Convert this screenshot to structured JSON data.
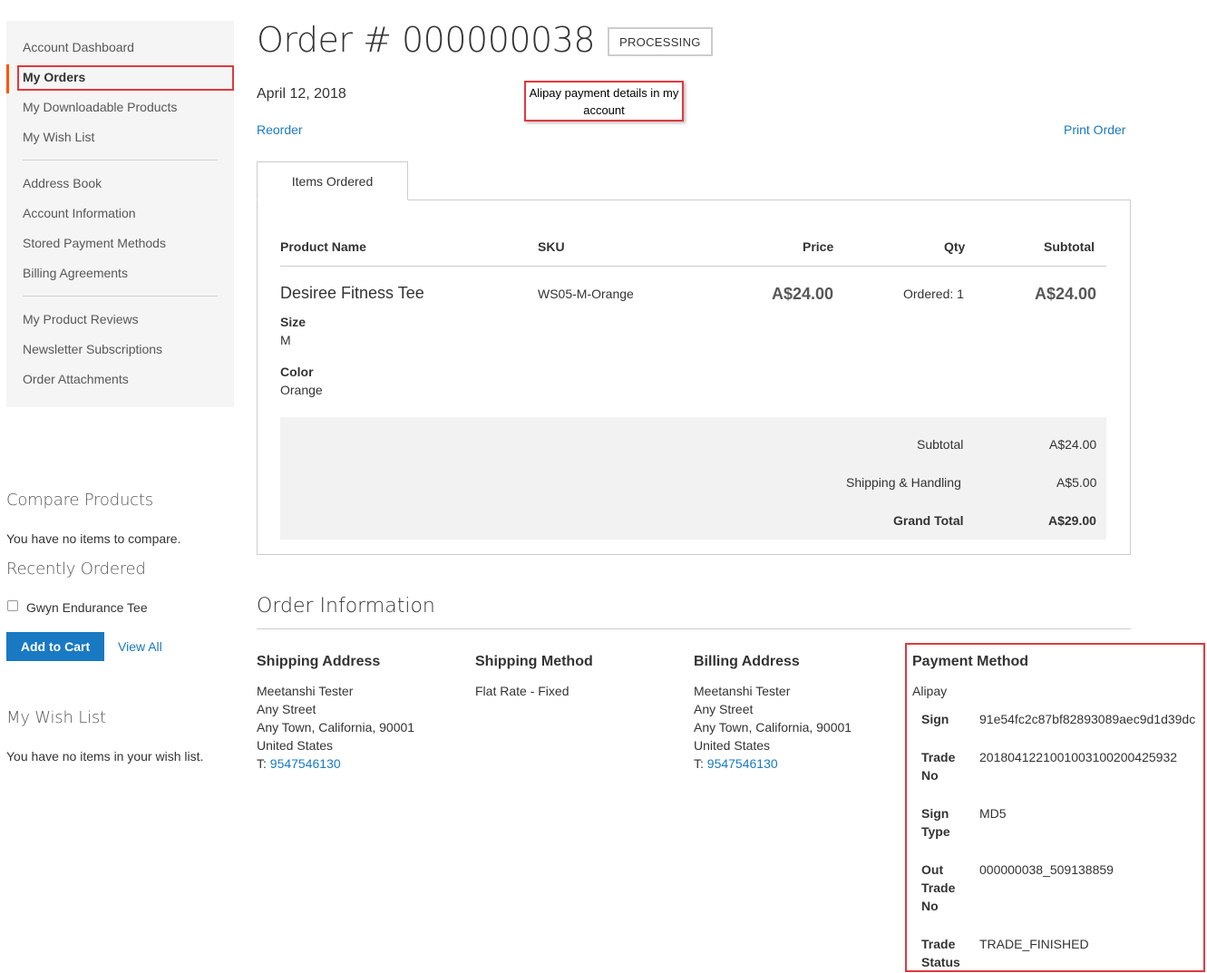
{
  "sidebar": {
    "nav_items": [
      "Account Dashboard",
      "My Orders",
      "My Downloadable Products",
      "My Wish List",
      "Address Book",
      "Account Information",
      "Stored Payment Methods",
      "Billing Agreements",
      "My Product Reviews",
      "Newsletter Subscriptions",
      "Order Attachments"
    ],
    "compare": {
      "title": "Compare Products",
      "empty": "You have no items to compare."
    },
    "recent": {
      "title": "Recently Ordered",
      "item": "Gwyn Endurance Tee",
      "add_to_cart": "Add to Cart",
      "view_all": "View All"
    },
    "wishlist": {
      "title": "My Wish List",
      "empty": "You have no items in your wish list."
    }
  },
  "order": {
    "title": "Order # 000000038",
    "status": "PROCESSING",
    "date": "April 12, 2018",
    "callout": "Alipay payment details in my account",
    "reorder": "Reorder",
    "print": "Print Order"
  },
  "items": {
    "tab": "Items Ordered",
    "headers": {
      "product": "Product Name",
      "sku": "SKU",
      "price": "Price",
      "qty": "Qty",
      "subtotal": "Subtotal"
    },
    "row": {
      "name": "Desiree Fitness Tee",
      "sku": "WS05-M-Orange",
      "price": "A$24.00",
      "qty": "Ordered: 1",
      "subtotal": "A$24.00",
      "options": [
        {
          "label": "Size",
          "value": "M"
        },
        {
          "label": "Color",
          "value": "Orange"
        }
      ]
    },
    "totals": [
      {
        "label": "Subtotal",
        "value": "A$24.00"
      },
      {
        "label": "Shipping & Handling",
        "value": "A$5.00"
      },
      {
        "label": "Grand Total",
        "value": "A$29.00"
      }
    ]
  },
  "info": {
    "title": "Order Information",
    "shipping_address": {
      "title": "Shipping Address",
      "lines": [
        "Meetanshi Tester",
        "Any Street",
        "Any Town, California, 90001",
        "United States"
      ],
      "phone_prefix": "T: ",
      "phone": "9547546130"
    },
    "shipping_method": {
      "title": "Shipping Method",
      "value": "Flat Rate - Fixed"
    },
    "billing_address": {
      "title": "Billing Address",
      "lines": [
        "Meetanshi Tester",
        "Any Street",
        "Any Town, California, 90001",
        "United States"
      ],
      "phone_prefix": "T: ",
      "phone": "9547546130"
    },
    "payment": {
      "title": "Payment Method",
      "method": "Alipay",
      "fields": [
        {
          "label": "Sign",
          "value": "91e54fc2c87bf82893089aec9d1d39dc"
        },
        {
          "label": "Trade No",
          "value": "2018041221001003100200425932"
        },
        {
          "label": "Sign Type",
          "value": "MD5"
        },
        {
          "label": "Out Trade No",
          "value": "000000038_509138859"
        },
        {
          "label": "Trade Status",
          "value": "TRADE_FINISHED"
        }
      ]
    }
  },
  "colors": {
    "link": "#1979c3",
    "accent": "#ff5501",
    "highlight": "#e0393e"
  }
}
